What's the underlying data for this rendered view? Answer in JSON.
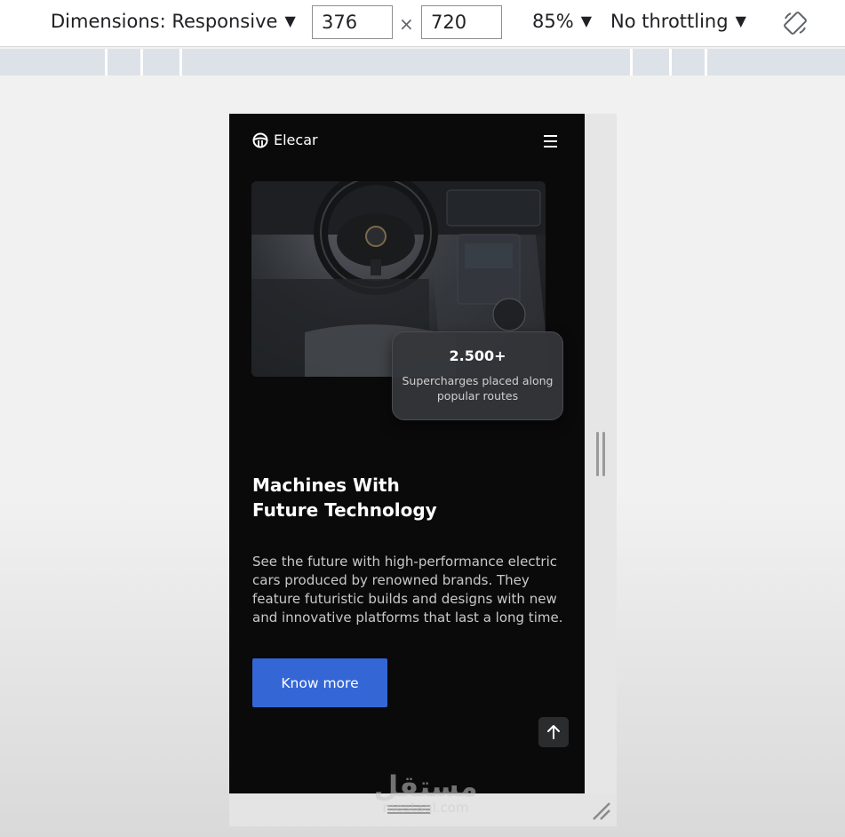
{
  "devtools": {
    "dimensions_label": "Dimensions: Responsive",
    "width_value": "376",
    "times_sign": "×",
    "height_value": "720",
    "zoom": "85%",
    "throttling": "No throttling",
    "icons": {
      "dropdown": "caret-down-icon",
      "rotate": "rotate-icon"
    }
  },
  "site": {
    "brand": "Elecar",
    "icons": {
      "logo": "steering-wheel-icon",
      "menu": "hamburger-menu-icon",
      "scroll_top": "arrow-up-icon"
    },
    "stat": {
      "value": "2.500+",
      "label": "Supercharges placed along popular routes"
    },
    "headline_line1": "Machines With",
    "headline_line2": "Future Technology",
    "description": "See the future with high-performance electric cars produced by renowned brands. They feature futuristic builds and designs with new and innovative platforms that last a long time.",
    "cta_label": "Know more"
  },
  "watermark": {
    "text": "مستقل",
    "sub": "mostaql.com"
  },
  "colors": {
    "page_bg": "#0a0a0a",
    "accent": "#3566d6",
    "card_bg": "#34363a",
    "toolbar_bg": "#ffffff"
  }
}
